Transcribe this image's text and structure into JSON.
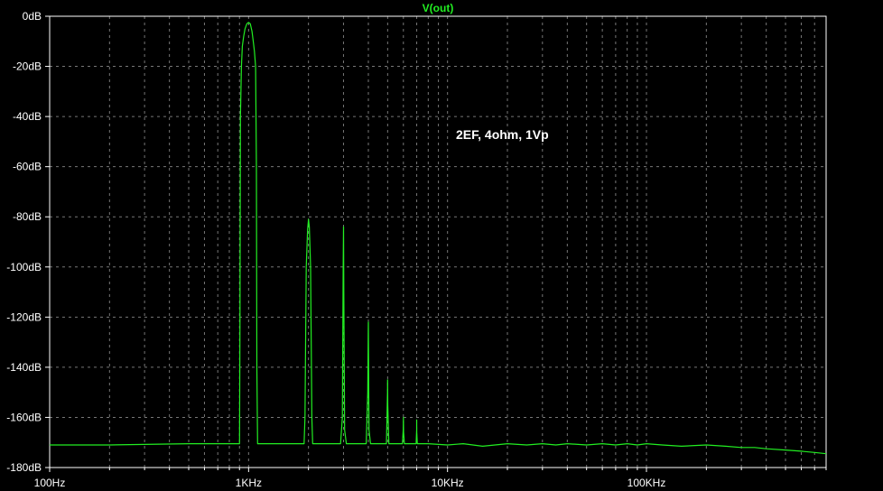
{
  "chart_data": {
    "type": "line",
    "title": "V(out)",
    "annotation": "2EF, 4ohm, 1Vp",
    "x_scale": "log",
    "xlim": [
      100,
      800000
    ],
    "ylim": [
      -180,
      0
    ],
    "grid": true,
    "colors": {
      "background": "#000000",
      "trace": "#22ee22",
      "frame": "#ffffff",
      "grid": "#777777"
    },
    "x_ticks": [
      {
        "value": 100,
        "label": "100Hz"
      },
      {
        "value": 1000,
        "label": "1KHz"
      },
      {
        "value": 10000,
        "label": "10KHz"
      },
      {
        "value": 100000,
        "label": "100KHz"
      }
    ],
    "y_ticks": [
      {
        "value": 0,
        "label": "0dB"
      },
      {
        "value": -20,
        "label": "-20dB"
      },
      {
        "value": -40,
        "label": "-40dB"
      },
      {
        "value": -60,
        "label": "-60dB"
      },
      {
        "value": -80,
        "label": "-80dB"
      },
      {
        "value": -100,
        "label": "-100dB"
      },
      {
        "value": -120,
        "label": "-120dB"
      },
      {
        "value": -140,
        "label": "-140dB"
      },
      {
        "value": -160,
        "label": "-160dB"
      },
      {
        "value": -180,
        "label": "-180dB"
      }
    ],
    "series": [
      {
        "x": [
          100,
          200,
          500,
          800,
          900,
          905,
          910,
          920,
          930,
          945,
          960,
          980,
          1000,
          1020,
          1040,
          1055,
          1070,
          1085,
          1095,
          1100,
          1110,
          1200,
          1500,
          1900,
          1920,
          1950,
          1980,
          2000,
          2020,
          2050,
          2080,
          2100,
          2200,
          2600,
          2900,
          2960,
          2990,
          3000,
          3010,
          3040,
          3100,
          3500,
          3900,
          3970,
          3995,
          4000,
          4005,
          4030,
          4100,
          4600,
          4930,
          4990,
          5000,
          5010,
          5070,
          5500,
          5930,
          5990,
          6000,
          6010,
          6070,
          6500,
          6950,
          6995,
          7000,
          7005,
          7050,
          8000,
          10000,
          12000,
          15000,
          20000,
          25000,
          30000,
          35000,
          40000,
          50000,
          60000,
          70000,
          80000,
          90000,
          100000,
          120000,
          150000,
          200000,
          250000,
          300000,
          350000,
          400000,
          500000,
          600000,
          700000,
          800000
        ],
        "y": [
          -171,
          -171,
          -170.5,
          -170.5,
          -170.5,
          -120,
          -40,
          -20,
          -12,
          -8,
          -5,
          -3,
          -2.5,
          -3,
          -6,
          -10,
          -14,
          -20,
          -60,
          -140,
          -170.5,
          -170.5,
          -170.5,
          -170.5,
          -160,
          -100,
          -85,
          -81,
          -84,
          -100,
          -160,
          -170.5,
          -170.5,
          -170.5,
          -170.5,
          -160,
          -100,
          -84,
          -110,
          -165,
          -170.5,
          -170.5,
          -170.5,
          -150,
          -125,
          -122,
          -130,
          -165,
          -170.5,
          -170.5,
          -170.5,
          -150,
          -145,
          -155,
          -170.5,
          -170.5,
          -170.5,
          -165,
          -160,
          -166,
          -170.5,
          -170.5,
          -170.5,
          -165,
          -161,
          -166,
          -170.5,
          -170.5,
          -171,
          -170.5,
          -171.5,
          -170.5,
          -171,
          -170.5,
          -171,
          -170.5,
          -171,
          -170.5,
          -171,
          -170.5,
          -171,
          -170.5,
          -171,
          -171.5,
          -171,
          -171.5,
          -172,
          -172,
          -172.5,
          -173,
          -173.5,
          -174,
          -174.5
        ]
      }
    ]
  }
}
